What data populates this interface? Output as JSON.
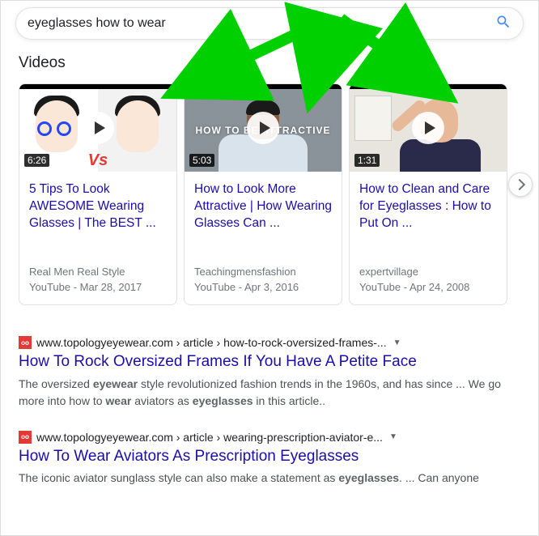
{
  "search": {
    "query": "eyeglasses how to wear"
  },
  "videos": {
    "heading": "Videos",
    "items": [
      {
        "duration": "6:26",
        "title": "5 Tips To Look AWESOME Wearing Glasses | The BEST ...",
        "channel": "Real Men Real Style",
        "source": "YouTube",
        "date": "Mar 28, 2017"
      },
      {
        "duration": "5:03",
        "title": "How to Look More Attractive | How Wearing Glasses Can ...",
        "channel": "Teachingmensfashion",
        "source": "YouTube",
        "date": "Apr 3, 2016",
        "thumb_text": "HOW TO BE\nATTRACTIVE"
      },
      {
        "duration": "1:31",
        "title": "How to Clean and Care for Eyeglasses : How to Put On ...",
        "channel": "expertvillage",
        "source": "YouTube",
        "date": "Apr 24, 2008"
      }
    ]
  },
  "results": [
    {
      "url": "www.topologyeyewear.com › article › how-to-rock-oversized-frames-...",
      "title": "How To Rock Oversized Frames If You Have A Petite Face",
      "snippet_pre": "The oversized ",
      "b1": "eyewear",
      "snippet_mid1": " style revolutionized fashion trends in the 1960s, and has since ... We go more into how to ",
      "b2": "wear",
      "snippet_mid2": " aviators as ",
      "b3": "eyeglasses",
      "snippet_post": " in this article.."
    },
    {
      "url": "www.topologyeyewear.com › article › wearing-prescription-aviator-e...",
      "title": "How To Wear Aviators As Prescription Eyeglasses",
      "snippet_pre": "The iconic aviator sunglass style can also make a statement as ",
      "b1": "eyeglasses",
      "snippet_post": ". ... Can anyone"
    }
  ]
}
